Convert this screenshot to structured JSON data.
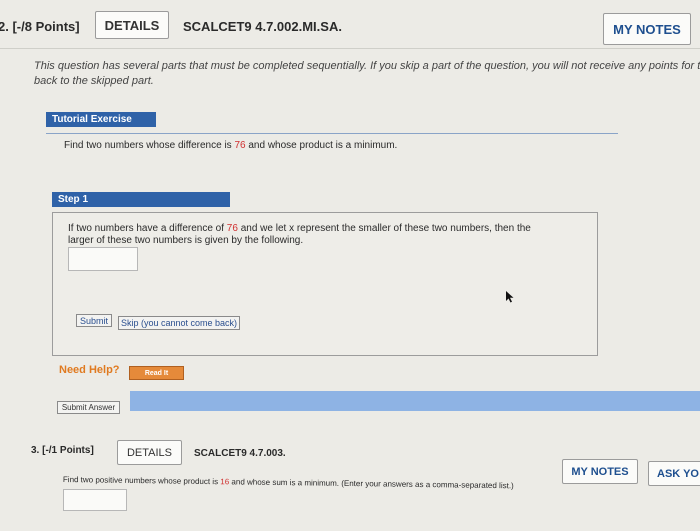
{
  "q2": {
    "header": {
      "points": "2. [-/8 Points]",
      "details": "DETAILS",
      "code": "SCALCET9 4.7.002.MI.SA.",
      "notes": "MY NOTES"
    },
    "intro": "This question has several parts that must be completed sequentially. If you skip a part of the question, you will not receive any points for the skipped part.",
    "intro_line2": "back to the skipped part.",
    "tutorial": {
      "label": "Tutorial Exercise",
      "problem_pre": "Find two numbers whose difference is ",
      "problem_num": "76",
      "problem_post": " and whose product is a minimum."
    },
    "step": {
      "label": "Step 1",
      "line1_pre": "If two numbers have a difference of ",
      "line1_num": "76",
      "line1_post": " and we let x represent the smaller of these two numbers, then the",
      "line2": "larger of these two numbers is given by the following.",
      "submit": "Submit",
      "skip": "Skip (you cannot come back)"
    },
    "help": {
      "label": "Need Help?",
      "read": "Read It"
    },
    "submit_answer": "Submit Answer"
  },
  "q3": {
    "header": {
      "points": "3. [-/1 Points]",
      "details": "DETAILS",
      "code": "SCALCET9 4.7.003.",
      "notes": "MY NOTES",
      "ask": "ASK YO"
    },
    "problem_pre": "Find two positive numbers whose product is ",
    "problem_num": "16",
    "problem_post": " and whose sum is a minimum. (Enter your answers as a comma-separated list.)"
  },
  "colors": {
    "accent_blue": "#2f62a8",
    "highlight_red": "#d03030",
    "help_orange": "#e07a20"
  }
}
